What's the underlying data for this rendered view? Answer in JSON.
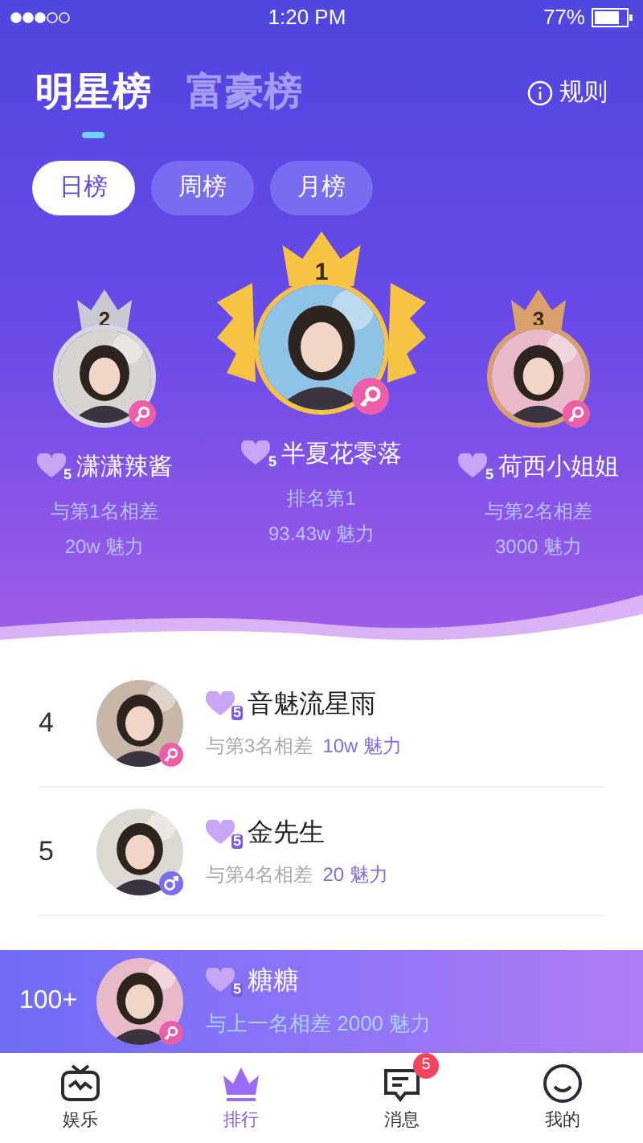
{
  "status_bar": {
    "time": "1:20 PM",
    "battery": "77%"
  },
  "header": {
    "tabs": [
      {
        "label": "明星榜",
        "selected": true
      },
      {
        "label": "富豪榜",
        "selected": false
      }
    ],
    "rules": "规则"
  },
  "periods": [
    {
      "label": "日榜",
      "selected": true
    },
    {
      "label": "周榜",
      "selected": false
    },
    {
      "label": "月榜",
      "selected": false
    }
  ],
  "podium": [
    {
      "kind": "silver",
      "rank": "2",
      "name": "潇潇辣酱",
      "badge": "5",
      "color": "#ec5fa8",
      "line1": "与第1名相差",
      "line2": "20w 魅力"
    },
    {
      "kind": "gold",
      "rank": "1",
      "name": "半夏花零落",
      "badge": "5",
      "color": "#ec5fa8",
      "line1": "排名第1",
      "line2": "93.43w 魅力"
    },
    {
      "kind": "bronze",
      "rank": "3",
      "name": "荷西小姐姐",
      "badge": "5",
      "color": "#ec5fa8",
      "line1": "与第2名相差",
      "line2": "3000 魅力"
    }
  ],
  "list": [
    {
      "rank": "4",
      "name": "音魅流星雨",
      "badge": "5",
      "color": "#ec5fa8",
      "gap_label": "与第3名相差",
      "gap_value": "10w 魅力"
    },
    {
      "rank": "5",
      "name": "金先生",
      "badge": "5",
      "color": "#7b6cf0",
      "gap_label": "与第4名相差",
      "gap_value": "20 魅力"
    }
  ],
  "my_rank": {
    "rank": "100+",
    "name": "糖糖",
    "badge": "5",
    "color": "#ec5fa8",
    "gap": "与上一名相差 2000 魅力"
  },
  "tab_bar": [
    {
      "label": "娱乐",
      "selected": false
    },
    {
      "label": "排行",
      "selected": true
    },
    {
      "label": "消息",
      "selected": false,
      "badge": "5"
    },
    {
      "label": "我的",
      "selected": false
    }
  ]
}
